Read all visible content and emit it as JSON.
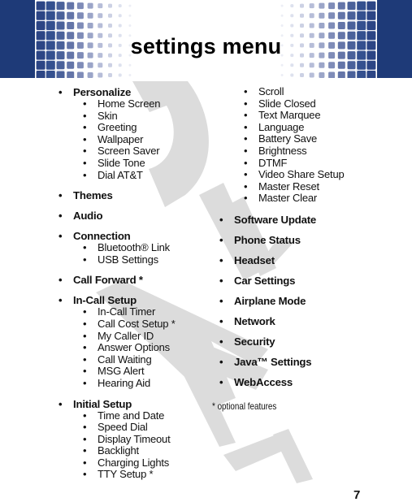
{
  "header": {
    "title": "settings menu",
    "brand_color": "#1e3a78"
  },
  "watermark": {
    "text": "DRAFT",
    "color": "#dcdcdc"
  },
  "left_column": [
    {
      "label": "Personalize",
      "children": [
        "Home Screen",
        "Skin",
        "Greeting",
        "Wallpaper",
        "Screen Saver",
        "Slide Tone",
        "Dial AT&T"
      ]
    },
    {
      "label": "Themes",
      "children": []
    },
    {
      "label": "Audio",
      "children": []
    },
    {
      "label": "Connection",
      "children": [
        "Bluetooth® Link",
        "USB Settings"
      ]
    },
    {
      "label": "Call Forward *",
      "children": []
    },
    {
      "label": "In-Call Setup",
      "children": [
        "In-Call Timer",
        "Call Cost Setup *",
        "My Caller ID",
        "Answer Options",
        "Call Waiting",
        "MSG Alert",
        "Hearing Aid"
      ]
    },
    {
      "label": "Initial Setup",
      "children": [
        "Time and Date",
        "Speed Dial",
        "Display Timeout",
        "Backlight",
        "Charging Lights",
        "TTY Setup *"
      ]
    }
  ],
  "right_column": {
    "continued_children": [
      "Scroll",
      "Slide Closed",
      "Text Marquee",
      "Language",
      "Battery Save",
      "Brightness",
      "DTMF",
      "Video Share Setup",
      "Master Reset",
      "Master Clear"
    ],
    "items": [
      "Software Update",
      "Phone Status",
      "Headset",
      "Car Settings",
      "Airplane Mode",
      "Network",
      "Security",
      "Java™ Settings",
      "WebAccess"
    ]
  },
  "footnote": "* optional features",
  "page_number": "7",
  "bullet_glyph": "•"
}
